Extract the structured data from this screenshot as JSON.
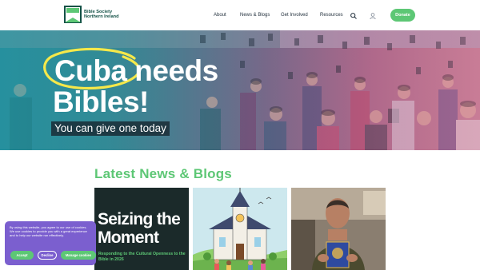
{
  "header": {
    "logo_line1": "Bible Society",
    "logo_line2": "Northern Ireland",
    "nav": [
      "About",
      "News & Blogs",
      "Get Involved",
      "Resources"
    ],
    "search_icon": "search-icon",
    "account_icon": "user-icon",
    "donate_label": "Donate"
  },
  "hero": {
    "line1": "Cuba needs",
    "line2": "Bibles!",
    "subtitle": "You can give one today"
  },
  "news": {
    "title": "Latest News & Blogs",
    "cards": [
      {
        "title_line1": "Seizing the",
        "title_line2": "Moment",
        "subtitle": "Responding to the Cultural Openness to the Bible in 2026"
      },
      {
        "image": "church-illustration"
      },
      {
        "image": "man-holding-bible-photo"
      }
    ]
  },
  "cookie": {
    "text": "By using this website, you agree to our use of cookies. We use cookies to provide you with a great experience and to help our website run effectively.",
    "accept": "Accept",
    "decline": "Decline",
    "manage": "Manage cookies"
  },
  "colors": {
    "brand_green": "#5dc775",
    "logo_teal": "#135146",
    "cookie_purple": "#7b5fcf",
    "hero_circle_yellow": "#f5e84a"
  }
}
